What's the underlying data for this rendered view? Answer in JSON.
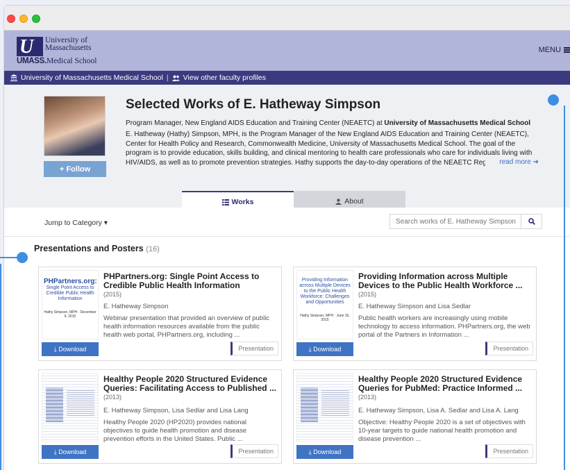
{
  "site": {
    "logo_line1": "University of",
    "logo_line2": "Massachusetts",
    "logo_line3_bold": "UMASS.",
    "logo_line3": "Medical School",
    "menu_label": "MENU"
  },
  "crumbs": {
    "institution": "University of Massachusetts Medical School",
    "separator": "|",
    "other_profiles": "View other faculty profiles"
  },
  "profile": {
    "follow_label": "+ Follow",
    "name": "Selected Works of E. Hatheway Simpson",
    "position_text": "Program Manager, New England AIDS Education and Training Center (NEAETC) at ",
    "position_org": "University of Massachusetts Medical School",
    "bio": "E. Hatheway (Hathy) Simpson, MPH, is the Program Manager of the New England AIDS Education and Training Center (NEAETC), Center for Health Policy and Research, Commonwealth Medicine, University of Massachusetts Medical School. The goal of the program is to provide education, skills building, and clinical mentoring to health care professionals who care for individuals living with HIV/AIDS, as well as to promote prevention strategies. Hathy supports the day-to-day operations of the NEAETC Regional",
    "read_more": "read more"
  },
  "tabs": [
    {
      "label": "Works",
      "icon": "grid-icon",
      "active": true
    },
    {
      "label": "About",
      "icon": "user-icon",
      "active": false
    }
  ],
  "toolbar": {
    "jump_label": "Jump to Category",
    "search_placeholder": "Search works of E. Hatheway Simpson"
  },
  "section": {
    "title": "Presentations and Posters",
    "count": "(16)"
  },
  "cards": [
    {
      "title": "PHPartners.org: Single Point Access to Credible Public Health Information",
      "year": "(2015)",
      "authors": "E. Hatheway Simpson",
      "description": "Webinar presentation that provided an overview of public health information resources available from the public health web portal, PHPartners.org, including ...",
      "download": "Download",
      "type": "Presentation",
      "thumb_title": "PHPartners.org:",
      "thumb_sub": "Single Point Access to Credible Public Health Information",
      "thumb_meta": "Hathy Simpson, MPH · December 9, 2015"
    },
    {
      "title": "Providing Information across Multiple Devices to the Public Health Workforce ...",
      "year": "(2015)",
      "authors": "E. Hatheway Simpson and Lisa Sedlar",
      "description": "Public health workers are increasingly using mobile technology to access information. PHPartners.org, the web portal of the Partners in Information ...",
      "download": "Download",
      "type": "Presentation",
      "thumb_title": "",
      "thumb_sub": "Providing Information across Multiple Devices to the Public Health Workforce: Challenges and Opportunities",
      "thumb_meta": "Hathy Simpson, MPH · June 16, 2015"
    },
    {
      "title": "Healthy People 2020 Structured Evidence Queries: Facilitating Access to Published ...",
      "year": "(2013)",
      "authors": "E. Hatheway Simpson, Lisa Sedlar and Lisa Lang",
      "description": "Healthy People 2020 (HP2020) provides national objectives to guide health promotion and disease prevention efforts in the United States. Public ...",
      "download": "Download",
      "type": "Presentation"
    },
    {
      "title": "Healthy People 2020 Structured Evidence Queries for PubMed: Practice Informed ...",
      "year": "(2013)",
      "authors": "E. Hatheway Simpson, Lisa A. Sedlar and Lisa A. Lang",
      "description": "Objective: Healthy People 2020 is a set of objectives with 10-year targets to guide national health promotion and disease prevention ...",
      "download": "Download",
      "type": "Presentation"
    }
  ]
}
